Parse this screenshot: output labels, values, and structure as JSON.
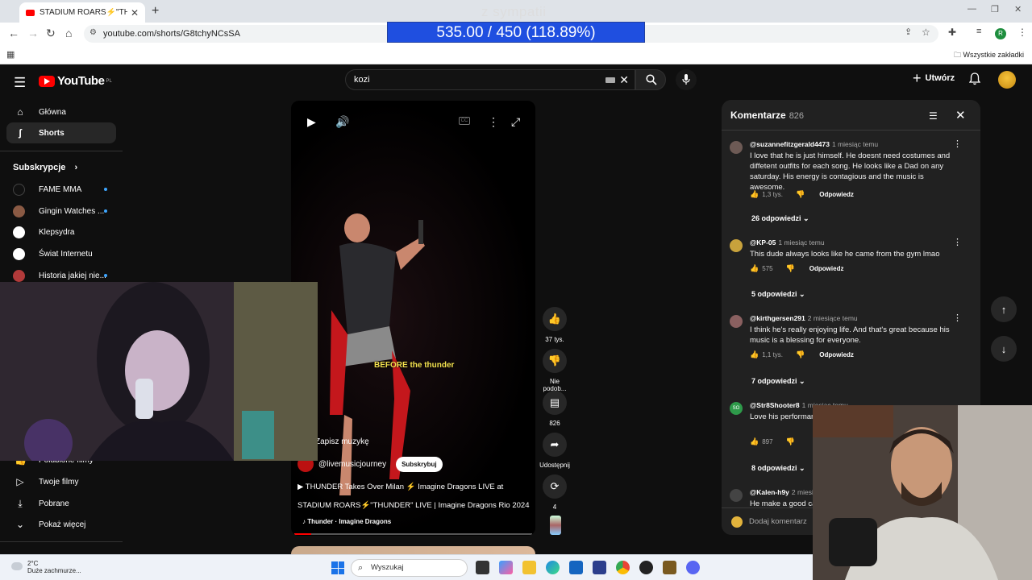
{
  "browser": {
    "tab_title": "STADIUM ROARS⚡\"THUNDER",
    "url": "youtube.com/shorts/G8tchyNCsSA",
    "bookmarks_all": "Wszystkie zakładki",
    "profile_initial": "R"
  },
  "stream_overlay": {
    "title": "z sympatii",
    "goal": "535.00 / 450 (118.89%)"
  },
  "youtube": {
    "logo": "YouTube",
    "region": "PL",
    "search_value": "kozi",
    "create_label": "Utwórz",
    "sidebar": {
      "main": [
        {
          "label": "Główna",
          "icon": "home-icon"
        },
        {
          "label": "Shorts",
          "icon": "shorts-icon"
        }
      ],
      "subs_heading": "Subskrypcje",
      "subscriptions": [
        {
          "label": "FAME MMA",
          "color": "#111111"
        },
        {
          "label": "Gingin Watches ...",
          "color": "#8a5a44"
        },
        {
          "label": "Klepsydra",
          "color": "#ffffff"
        },
        {
          "label": "Świat Internetu",
          "color": "#ffffff"
        },
        {
          "label": "Historia jakiej nie...",
          "color": "#b23a3a"
        }
      ],
      "you": [
        {
          "label": "Polubione filmy",
          "icon": "like-icon"
        },
        {
          "label": "Twoje filmy",
          "icon": "video-icon"
        },
        {
          "label": "Pobrane",
          "icon": "download-icon"
        },
        {
          "label": "Pokaż więcej",
          "icon": "chevron-down-icon"
        }
      ]
    },
    "video": {
      "caption": "BEFORE the thunder",
      "save_music": "Zapisz muzykę",
      "channel": "@livemusicjourney",
      "subscribe": "Subskrybuj",
      "desc_line1": "▶ THUNDER Takes Over Milan ⚡ Imagine Dragons LIVE at",
      "desc_line2": "STADIUM ROARS⚡\"THUNDER\" LIVE | Imagine Dragons Rio 2024",
      "music": "Thunder · Imagine Dragons",
      "progress": 0.07
    },
    "actions": {
      "likes": "37 tys.",
      "dislike": "Nie podob...",
      "comments": "826",
      "share": "Udostępnij",
      "remix": "4"
    },
    "comments": {
      "title": "Komentarze",
      "count": "826",
      "add_placeholder": "Dodaj komentarz",
      "reply_label": "Odpowiedz",
      "items": [
        {
          "user": "@suzannefitzgerald4473",
          "time": "1 miesiąc temu",
          "text": "I love that he is just himself. He doesnt need costumes and diffetent outfits for each song. He looks like a Dad on any saturday. His energy is contagious and the music is awesome.",
          "likes": "1,3 tys.",
          "replies": "26 odpowiedzi",
          "color": "#6d5a55"
        },
        {
          "user": "@KP-05",
          "time": "1 miesiąc temu",
          "text": "This dude always looks like he came from the gym lmao",
          "likes": "575",
          "replies": "5 odpowiedzi",
          "color": "#c8a23c"
        },
        {
          "user": "@kirthgersen291",
          "time": "2 miesiące temu",
          "text": "I think he's really enjoying life. And that's great because his music is a blessing for everyone.",
          "likes": "1,1 tys.",
          "replies": "7 odpowiedzi",
          "color": "#8a6060"
        },
        {
          "user": "@Str8Shooter8",
          "time": "1 miesiąc temu",
          "text": "Love his performance ... would wear and ha...",
          "likes": "897",
          "replies": "8 odpowiedzi",
          "avatar_text": "SO",
          "color": "#2e9a4a"
        },
        {
          "user": "@Kalen-h9y",
          "time": "2 miesiące temu",
          "text": "He make a good ca...",
          "likes": "",
          "replies": "",
          "color": "#444444"
        }
      ]
    }
  },
  "taskbar": {
    "temp": "2°C",
    "weather": "Duże zachmurze...",
    "search": "Wyszukaj"
  }
}
